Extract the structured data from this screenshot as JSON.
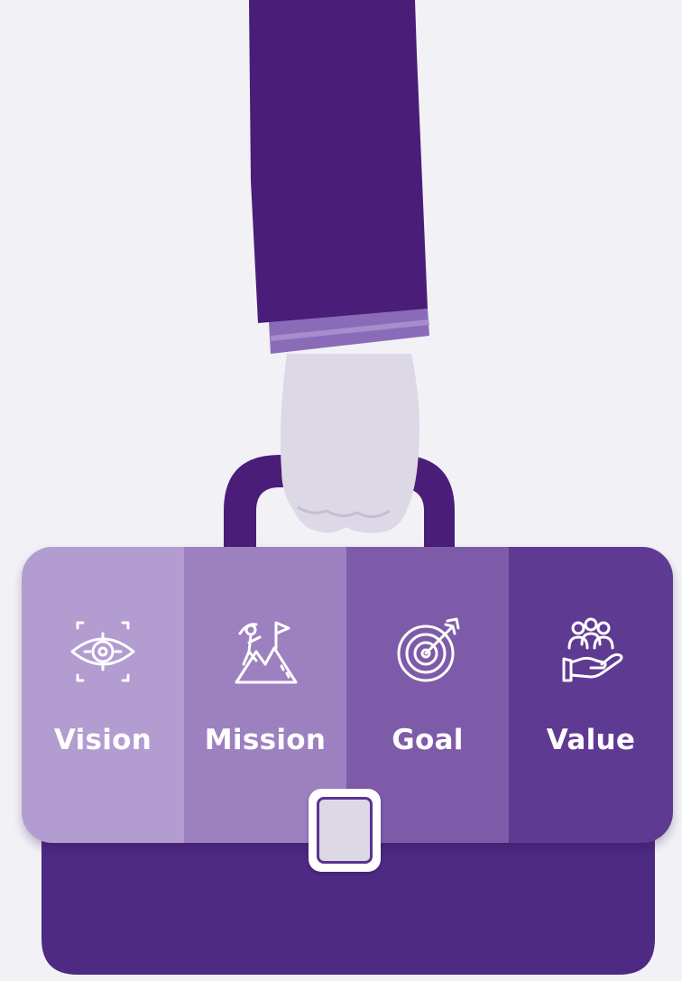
{
  "illustration": {
    "theme": "hand-holding-briefcase",
    "colors": {
      "background": "#f2f1f5",
      "sleeve": "#4a1d78",
      "cuff": "#8a6bb8",
      "hand": "#dcd8e6",
      "handle": "#4a1d78",
      "case_body": "#4e2a82",
      "panel_1": "#b29cd0",
      "panel_2": "#9c80c0",
      "panel_3": "#7e5ba8",
      "panel_4": "#5f3a92"
    }
  },
  "panels": [
    {
      "label": "Vision",
      "icon": "eye-target-icon"
    },
    {
      "label": "Mission",
      "icon": "mountain-climber-flag-icon"
    },
    {
      "label": "Goal",
      "icon": "target-arrow-icon"
    },
    {
      "label": "Value",
      "icon": "people-in-hand-icon"
    }
  ]
}
